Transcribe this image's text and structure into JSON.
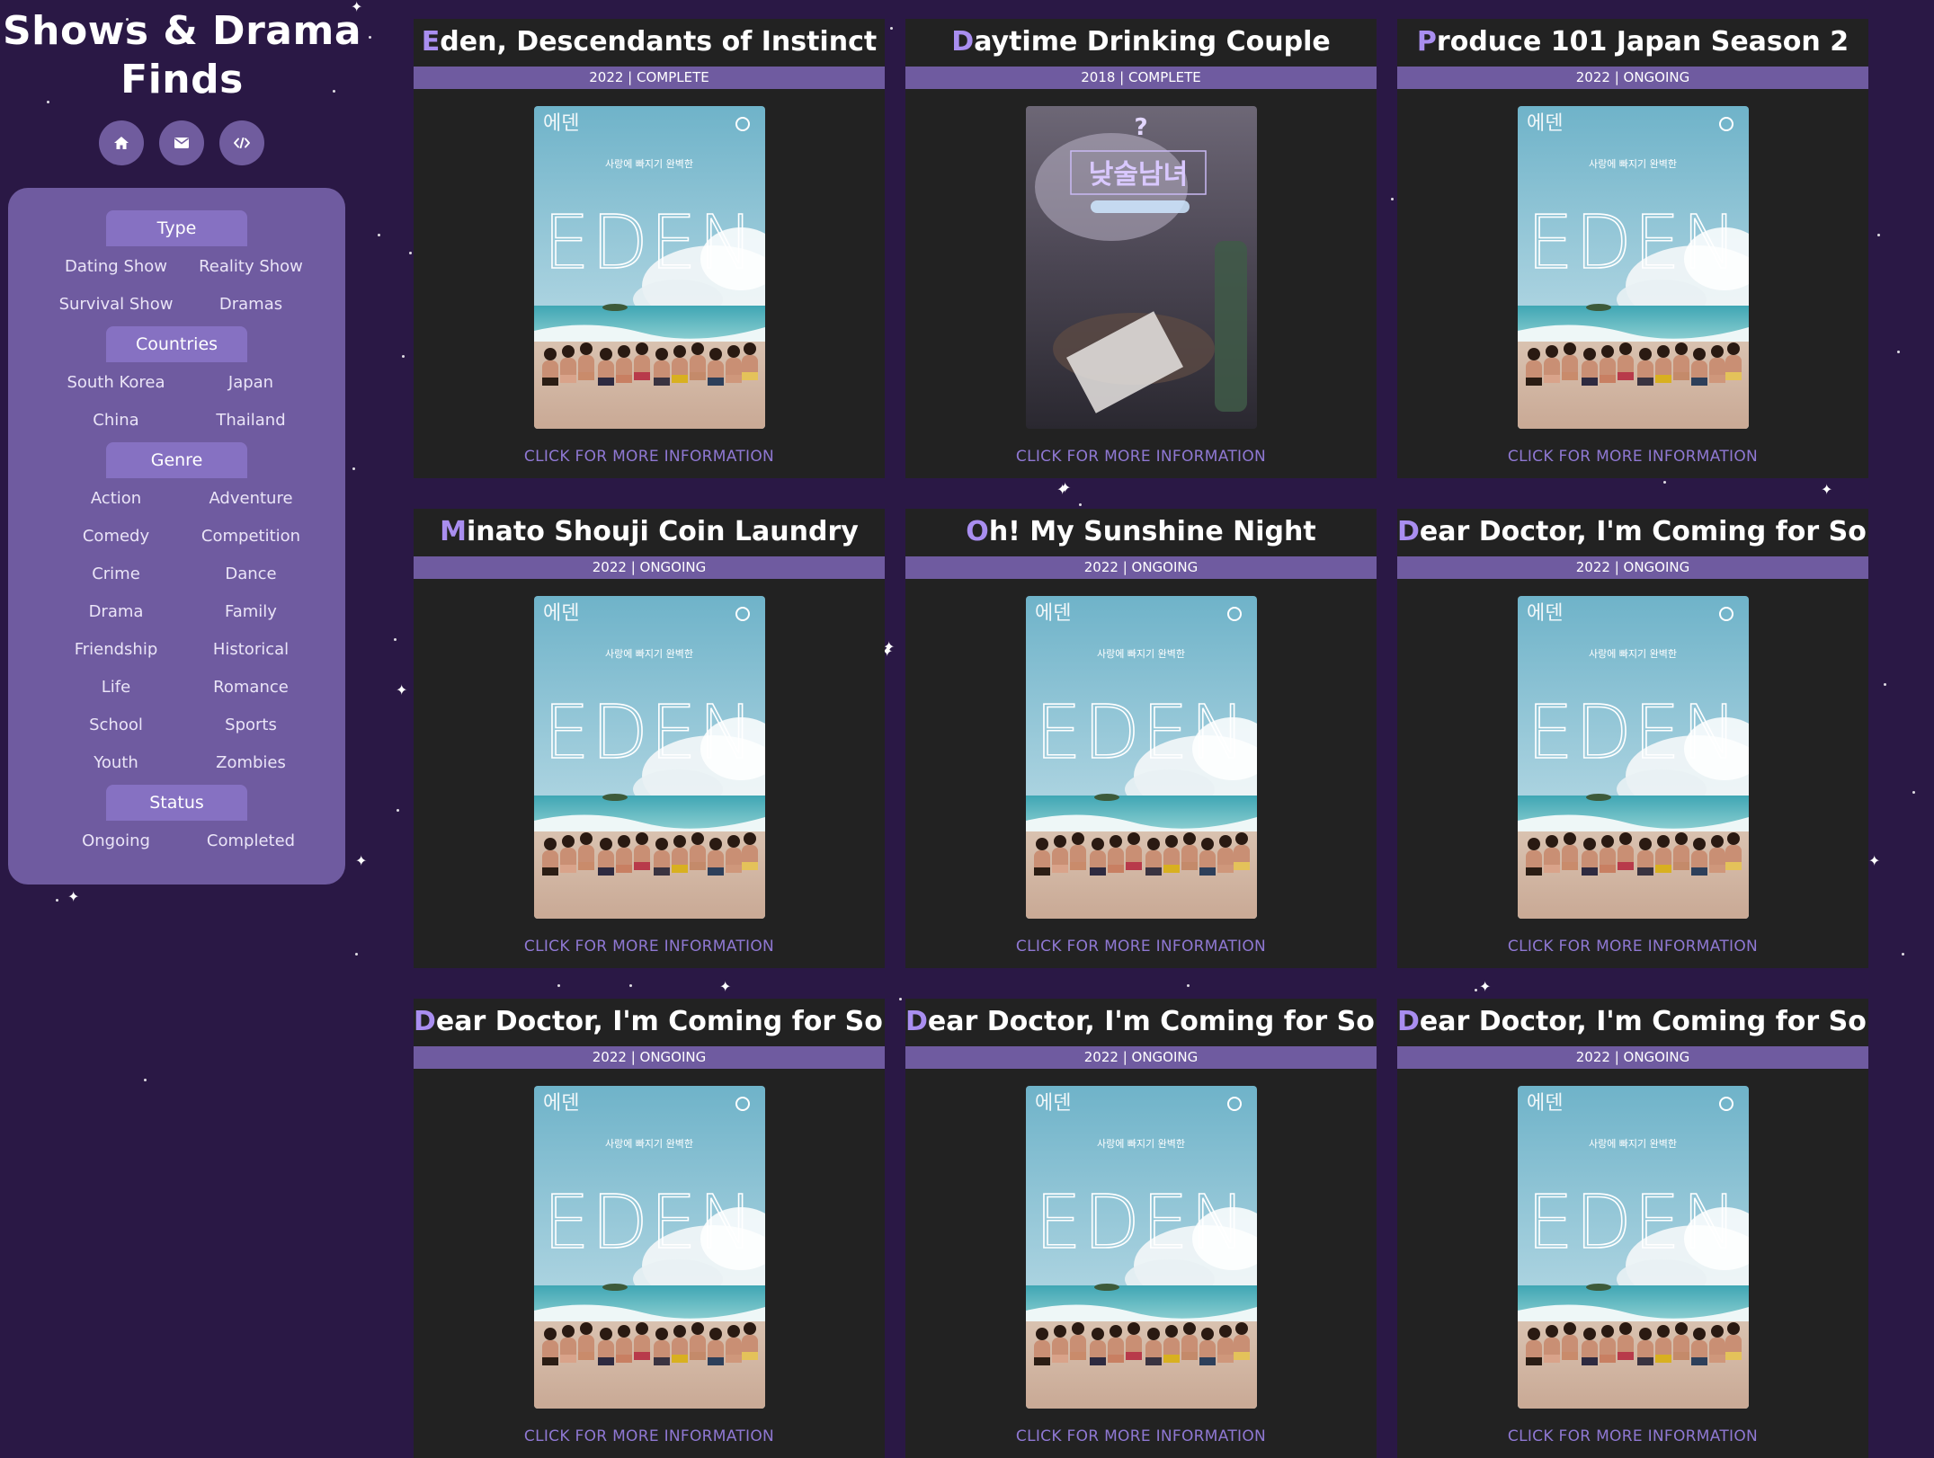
{
  "site": {
    "title_line1": "Shows & Drama",
    "title_line2": "Finds",
    "icons": [
      "home-icon",
      "mail-icon",
      "code-icon"
    ]
  },
  "filters": {
    "type": {
      "label": "Type",
      "items": [
        "Dating Show",
        "Reality Show",
        "Survival Show",
        "Dramas"
      ]
    },
    "countries": {
      "label": "Countries",
      "items": [
        "South Korea",
        "Japan",
        "China",
        "Thailand"
      ]
    },
    "genre": {
      "label": "Genre",
      "items": [
        "Action",
        "Adventure",
        "Comedy",
        "Competition",
        "Crime",
        "Dance",
        "Drama",
        "Family",
        "Friendship",
        "Historical",
        "Life",
        "Romance",
        "School",
        "Sports",
        "Youth",
        "Zombies"
      ]
    },
    "status": {
      "label": "Status",
      "items": [
        "Ongoing",
        "Completed"
      ]
    }
  },
  "cards": [
    {
      "first": "E",
      "rest": "den, Descendants of Instinct",
      "meta": "2022 | COMPLETE",
      "poster": "eden",
      "link": "CLICK FOR MORE INFORMATION"
    },
    {
      "first": "D",
      "rest": "aytime Drinking Couple",
      "meta": "2018 | COMPLETE",
      "poster": "drinking",
      "link": "CLICK FOR MORE INFORMATION"
    },
    {
      "first": "P",
      "rest": "roduce 101 Japan Season 2",
      "meta": "2022 | ONGOING",
      "poster": "eden",
      "link": "CLICK FOR MORE INFORMATION"
    },
    {
      "first": "M",
      "rest": "inato Shouji Coin Laundry",
      "meta": "2022 | ONGOING",
      "poster": "eden",
      "link": "CLICK FOR MORE INFORMATION"
    },
    {
      "first": "O",
      "rest": "h! My Sunshine Night",
      "meta": "2022 | ONGOING",
      "poster": "eden",
      "link": "CLICK FOR MORE INFORMATION"
    },
    {
      "first": "D",
      "rest": "ear Doctor, I'm Coming for Soul",
      "meta": "2022 | ONGOING",
      "poster": "eden",
      "link": "CLICK FOR MORE INFORMATION"
    },
    {
      "first": "D",
      "rest": "ear Doctor, I'm Coming for Soul",
      "meta": "2022 | ONGOING",
      "poster": "eden",
      "link": "CLICK FOR MORE INFORMATION"
    },
    {
      "first": "D",
      "rest": "ear Doctor, I'm Coming for Soul",
      "meta": "2022 | ONGOING",
      "poster": "eden",
      "link": "CLICK FOR MORE INFORMATION"
    },
    {
      "first": "D",
      "rest": "ear Doctor, I'm Coming for Soul",
      "meta": "2022 | ONGOING",
      "poster": "eden",
      "link": "CLICK FOR MORE INFORMATION"
    }
  ],
  "posters": {
    "eden": {
      "logo": "에덴",
      "tagline": "사랑에 빠지기 완벽한",
      "word": "EDEN"
    },
    "drinking": {
      "logo": "낮술남녀"
    }
  },
  "colors": {
    "background": "#2a1845",
    "panel": "#6f5ba0",
    "panel_header": "#8671c2",
    "card": "#222222",
    "accent_letter": "#a98ef0",
    "link": "#8f78d3"
  }
}
